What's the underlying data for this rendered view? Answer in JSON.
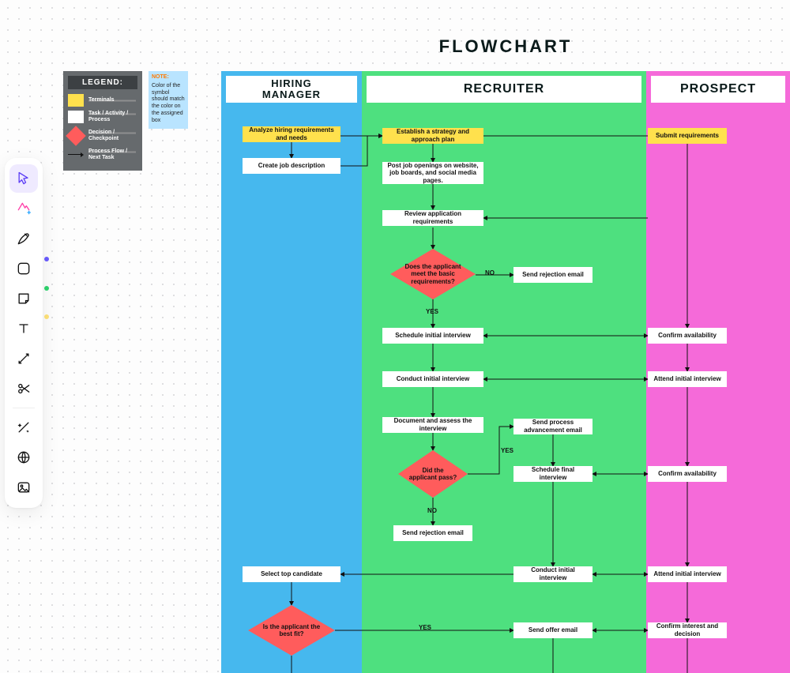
{
  "page": {
    "title": "FLOWCHART"
  },
  "lanes": {
    "left": "HIRING\nMANAGER",
    "mid": "RECRUITER",
    "right": "PROSPECT"
  },
  "legend": {
    "title": "LEGEND:",
    "terminals": "Terminals",
    "process": "Task / Activity / Process",
    "decision": "Decision / Checkpoint",
    "flow": "Process Flow / Next Task"
  },
  "note": {
    "heading": "NOTE:",
    "body": "Color of the symbol should match the color on the assigned box"
  },
  "nodes": {
    "hm_analyze": "Analyze hiring requirements and needs",
    "hm_jobdesc": "Create job description",
    "r_strategy": "Establish a strategy and approach plan",
    "r_post": "Post job openings on website, job boards, and social media pages.",
    "r_review": "Review application requirements",
    "r_basic_req": "Does the applicant meet the basic requirements?",
    "r_reject1": "Send rejection email",
    "r_schedule1": "Schedule initial interview",
    "r_conduct1": "Conduct initial interview",
    "r_assess": "Document and assess the interview",
    "r_pass": "Did the applicant pass?",
    "r_advance_email": "Send process advancement email",
    "r_schedule_final": "Schedule final interview",
    "r_reject2": "Send rejection email",
    "hm_select": "Select top candidate",
    "r_conduct2": "Conduct initial interview",
    "hm_bestfit": "Is the applicant the best fit?",
    "r_offer": "Send offer email",
    "p_submit": "Submit requirements",
    "p_confirm1": "Confirm availability",
    "p_attend1": "Attend initial interview",
    "p_confirm2": "Confirm availability",
    "p_attend2": "Attend initial interview",
    "p_confirm_int": "Confirm interest and decision"
  },
  "edge_labels": {
    "no1": "NO",
    "yes1": "YES",
    "yes2": "YES",
    "no2": "NO",
    "yes3": "YES"
  }
}
